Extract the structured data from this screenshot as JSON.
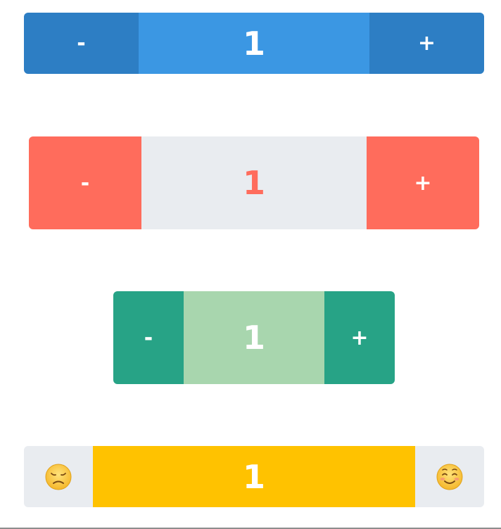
{
  "steppers": [
    {
      "decrement_label": "-",
      "value": "1",
      "increment_label": "+"
    },
    {
      "decrement_label": "-",
      "value": "1",
      "increment_label": "+"
    },
    {
      "decrement_label": "-",
      "value": "1",
      "increment_label": "+"
    },
    {
      "decrement_icon": "sad-face-icon",
      "value": "1",
      "increment_icon": "smiling-face-icon"
    }
  ],
  "colors": {
    "blue_button": "#2d7ec4",
    "blue_value": "#3b97e3",
    "coral": "#ff6c5c",
    "light_gray": "#e9ecf0",
    "teal": "#27a386",
    "mint": "#a8d6ae",
    "yellow": "#ffc200"
  }
}
